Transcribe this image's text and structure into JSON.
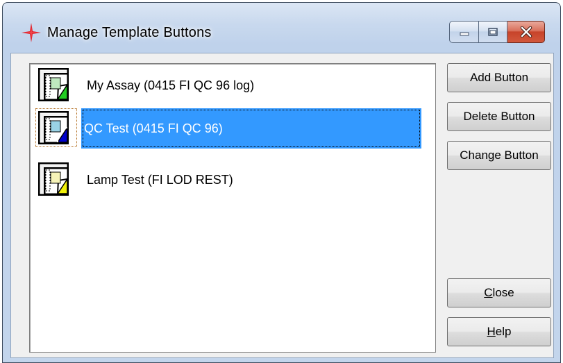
{
  "window": {
    "title": "Manage Template Buttons"
  },
  "icons": {
    "app": "red-four-point-star-icon",
    "item_green": "green-template-document-icon",
    "item_blue": "blue-template-document-icon",
    "item_yellow": "yellow-template-document-icon",
    "minimize": "minimize-icon",
    "maximize": "maximize-icon",
    "close": "close-icon"
  },
  "colors": {
    "selection": "#3399ff",
    "green_tag": "#22cc22",
    "blue_tag": "#0000cc",
    "yellow_tag": "#f2f20a",
    "app_icon_red": "#e0202a"
  },
  "list": {
    "items": [
      {
        "label": "My Assay (0415 FI QC 96 log)",
        "selected": false
      },
      {
        "label": "QC Test (0415 FI QC 96)",
        "selected": true
      },
      {
        "label": "Lamp Test (FI LOD REST)",
        "selected": false
      }
    ]
  },
  "buttons": {
    "add": "Add Button",
    "delete": "Delete Button",
    "change": "Change Button",
    "close_accel": "C",
    "close_rest": "lose",
    "help_accel": "H",
    "help_rest": "elp"
  }
}
